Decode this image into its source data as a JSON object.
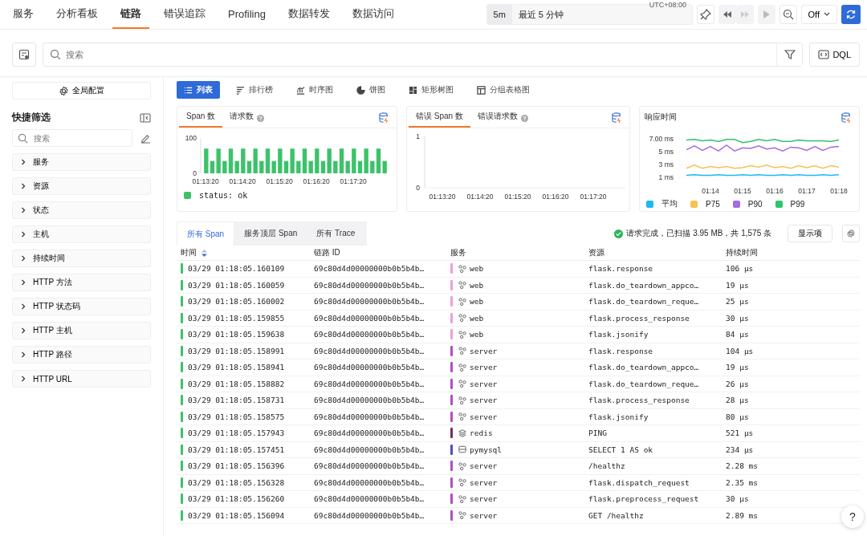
{
  "nav": {
    "tabs": [
      {
        "label": "服务",
        "selected": false
      },
      {
        "label": "分析看板",
        "selected": false
      },
      {
        "label": "链路",
        "selected": true
      },
      {
        "label": "错误追踪",
        "selected": false
      },
      {
        "label": "Profiling",
        "selected": false
      },
      {
        "label": "数据转发",
        "selected": false
      },
      {
        "label": "数据访问",
        "selected": false
      }
    ]
  },
  "time_range": {
    "preset": "5m",
    "label": "最近 5 分钟",
    "timezone": "UTC+08:00"
  },
  "refresh": {
    "label": "Off"
  },
  "search": {
    "placeholder": "搜索",
    "dql_label": "DQL"
  },
  "sidebar": {
    "config_button": "全局配置",
    "title": "快捷筛选",
    "search_placeholder": "搜索",
    "filters": [
      {
        "label": "服务",
        "expanded": false
      },
      {
        "label": "资源",
        "expanded": false
      },
      {
        "label": "状态",
        "expanded": false
      },
      {
        "label": "主机",
        "expanded": false
      },
      {
        "label": "持续时间",
        "expanded": false
      },
      {
        "label": "HTTP 方法",
        "expanded": false
      },
      {
        "label": "HTTP 状态码",
        "expanded": false
      },
      {
        "label": "HTTP 主机",
        "expanded": false
      },
      {
        "label": "HTTP 路径",
        "expanded": false
      },
      {
        "label": "HTTP URL",
        "expanded": false
      }
    ]
  },
  "view_tabs": [
    {
      "label": "列表",
      "kind": "list",
      "selected": true
    },
    {
      "label": "排行榜",
      "kind": "rank",
      "selected": false
    },
    {
      "label": "时序图",
      "kind": "timeseries",
      "selected": false
    },
    {
      "label": "饼图",
      "kind": "pie",
      "selected": false
    },
    {
      "label": "矩形树图",
      "kind": "treemap",
      "selected": false
    },
    {
      "label": "分组表格图",
      "kind": "table",
      "selected": false
    }
  ],
  "charts": [
    {
      "tabs": [
        {
          "label": "Span 数",
          "selected": true
        },
        {
          "label": "请求数",
          "selected": false,
          "help_icon": "?"
        }
      ],
      "chart_data": {
        "type": "bar",
        "ylim": [
          0,
          100
        ],
        "yticks": [
          0,
          100
        ],
        "categories": [
          "01:13:20",
          null,
          null,
          null,
          null,
          null,
          "01:14:20",
          null,
          null,
          null,
          null,
          null,
          "01:15:20",
          null,
          null,
          null,
          null,
          null,
          "01:16:20",
          null,
          null,
          null,
          null,
          null,
          "01:17:20",
          null,
          null,
          null,
          null,
          null
        ],
        "series": [
          {
            "name": "status: ok",
            "color": "#3cc26a",
            "values": [
              70,
              35,
              70,
              35,
              70,
              35,
              70,
              35,
              70,
              35,
              70,
              35,
              70,
              35,
              70,
              35,
              70,
              35,
              70,
              35,
              70,
              35,
              70,
              35,
              70,
              35,
              70,
              35,
              70,
              35
            ]
          }
        ]
      }
    },
    {
      "tabs": [
        {
          "label": "错误 Span 数",
          "selected": true
        },
        {
          "label": "错误请求数",
          "selected": false,
          "help_icon": "?"
        }
      ],
      "chart_data": {
        "type": "line",
        "ylim": [
          0,
          1
        ],
        "yticks": [
          0,
          1
        ],
        "categories": [
          "01:13:20",
          "01:14:20",
          "01:15:20",
          "01:16:20",
          "01:17:20"
        ]
      }
    },
    {
      "title": "响应时间",
      "chart_data": {
        "type": "line",
        "grid": true,
        "ylim": [
          1,
          7
        ],
        "yticks": [
          {
            "value": 1,
            "label": "1 ms"
          },
          {
            "value": 3,
            "label": "3 ms"
          },
          {
            "value": 5,
            "label": "5 ms"
          },
          {
            "value": 7,
            "label": "7.00 ms"
          }
        ],
        "categories": [
          null,
          null,
          null,
          "01:14",
          null,
          null,
          null,
          "01:15",
          null,
          null,
          null,
          "01:16",
          null,
          null,
          null,
          "01:17",
          null,
          null,
          null,
          "01:18"
        ],
        "series": [
          {
            "name": "平均",
            "color": "#1fb8f0",
            "values": [
              1.3,
              1.4,
              1.3,
              1.3,
              1.4,
              1.3,
              1.3,
              1.4,
              1.3,
              1.4,
              1.3,
              1.3,
              1.4,
              1.3,
              1.4,
              1.3,
              1.3,
              1.4,
              1.3,
              1.4
            ]
          },
          {
            "name": "P75",
            "color": "#f5c350",
            "values": [
              2.4,
              2.9,
              2.4,
              2.7,
              2.5,
              2.7,
              2.4,
              2.5,
              2.8,
              2.6,
              2.9,
              2.5,
              2.7,
              2.4,
              2.8,
              2.5,
              2.8,
              2.4,
              2.8,
              2.6
            ]
          },
          {
            "name": "P90",
            "color": "#a66be0",
            "values": [
              5.3,
              5.9,
              5.2,
              5.8,
              5.1,
              6.0,
              5.1,
              5.6,
              5.5,
              5.9,
              5.4,
              5.6,
              5.1,
              5.7,
              5.6,
              5.2,
              5.8,
              5.2,
              5.7,
              5.8
            ]
          },
          {
            "name": "P99",
            "color": "#2ec46c",
            "values": [
              6.8,
              6.9,
              6.7,
              6.8,
              6.6,
              6.9,
              6.9,
              6.4,
              6.6,
              6.9,
              6.7,
              6.9,
              6.6,
              6.6,
              6.8,
              6.7,
              6.7,
              6.7,
              6.6,
              6.8
            ]
          }
        ]
      }
    }
  ],
  "table_tabs": [
    {
      "label": "所有 Span",
      "selected": true
    },
    {
      "label": "服务顶层 Span",
      "selected": false
    },
    {
      "label": "所有 Trace",
      "selected": false
    }
  ],
  "status": "请求完成，已扫描 3.95 MB，共 1,575 条",
  "display_button": "显示项",
  "table": {
    "columns": [
      {
        "label": "时间",
        "sort_descending": true
      },
      {
        "label": "链路 ID"
      },
      {
        "label": "服务"
      },
      {
        "label": "资源"
      },
      {
        "label": "持续时间"
      }
    ],
    "rows": [
      {
        "time": "03/29 01:18:05.160109",
        "trace_id": "69c80d4d00000000b0b5b4b…",
        "service": "web",
        "kind": "app",
        "color": "#e9a0e0",
        "resource": "flask.response",
        "duration": "106 µs"
      },
      {
        "time": "03/29 01:18:05.160059",
        "trace_id": "69c80d4d00000000b0b5b4b…",
        "service": "web",
        "kind": "app",
        "color": "#e9a0e0",
        "resource": "flask.do_teardown_appco…",
        "duration": "19 µs"
      },
      {
        "time": "03/29 01:18:05.160002",
        "trace_id": "69c80d4d00000000b0b5b4b…",
        "service": "web",
        "kind": "app",
        "color": "#e9a0e0",
        "resource": "flask.do_teardown_reque…",
        "duration": "25 µs"
      },
      {
        "time": "03/29 01:18:05.159855",
        "trace_id": "69c80d4d00000000b0b5b4b…",
        "service": "web",
        "kind": "app",
        "color": "#e9a0e0",
        "resource": "flask.process_response",
        "duration": "30 µs"
      },
      {
        "time": "03/29 01:18:05.159638",
        "trace_id": "69c80d4d00000000b0b5b4b…",
        "service": "web",
        "kind": "app",
        "color": "#e9a0e0",
        "resource": "flask.jsonify",
        "duration": "84 µs"
      },
      {
        "time": "03/29 01:18:05.158991",
        "trace_id": "69c80d4d00000000b0b5b4b…",
        "service": "server",
        "kind": "app",
        "color": "#b04fc0",
        "resource": "flask.response",
        "duration": "104 µs"
      },
      {
        "time": "03/29 01:18:05.158941",
        "trace_id": "69c80d4d00000000b0b5b4b…",
        "service": "server",
        "kind": "app",
        "color": "#b04fc0",
        "resource": "flask.do_teardown_appco…",
        "duration": "19 µs"
      },
      {
        "time": "03/29 01:18:05.158882",
        "trace_id": "69c80d4d00000000b0b5b4b…",
        "service": "server",
        "kind": "app",
        "color": "#b04fc0",
        "resource": "flask.do_teardown_reque…",
        "duration": "26 µs"
      },
      {
        "time": "03/29 01:18:05.158731",
        "trace_id": "69c80d4d00000000b0b5b4b…",
        "service": "server",
        "kind": "app",
        "color": "#b04fc0",
        "resource": "flask.process_response",
        "duration": "28 µs"
      },
      {
        "time": "03/29 01:18:05.158575",
        "trace_id": "69c80d4d00000000b0b5b4b…",
        "service": "server",
        "kind": "app",
        "color": "#b04fc0",
        "resource": "flask.jsonify",
        "duration": "80 µs"
      },
      {
        "time": "03/29 01:18:05.157943",
        "trace_id": "69c80d4d00000000b0b5b4b…",
        "service": "redis",
        "kind": "cache",
        "color": "#7a2d5a",
        "resource": "PING",
        "duration": "521 µs"
      },
      {
        "time": "03/29 01:18:05.157451",
        "trace_id": "69c80d4d00000000b0b5b4b…",
        "service": "pymysql",
        "kind": "db",
        "color": "#4c4ccc",
        "resource": "SELECT 1 AS ok",
        "duration": "234 µs"
      },
      {
        "time": "03/29 01:18:05.156396",
        "trace_id": "69c80d4d00000000b0b5b4b…",
        "service": "server",
        "kind": "app",
        "color": "#b04fc0",
        "resource": "/healthz",
        "duration": "2.28 ms"
      },
      {
        "time": "03/29 01:18:05.156328",
        "trace_id": "69c80d4d00000000b0b5b4b…",
        "service": "server",
        "kind": "app",
        "color": "#b04fc0",
        "resource": "flask.dispatch_request",
        "duration": "2.35 ms"
      },
      {
        "time": "03/29 01:18:05.156260",
        "trace_id": "69c80d4d00000000b0b5b4b…",
        "service": "server",
        "kind": "app",
        "color": "#b04fc0",
        "resource": "flask.preprocess_request",
        "duration": "30 µs"
      },
      {
        "time": "03/29 01:18:05.156094",
        "trace_id": "69c80d4d00000000b0b5b4b…",
        "service": "server",
        "kind": "app",
        "color": "#b04fc0",
        "resource": "GET /healthz",
        "duration": "2.89 ms"
      }
    ]
  },
  "help_button": "?"
}
